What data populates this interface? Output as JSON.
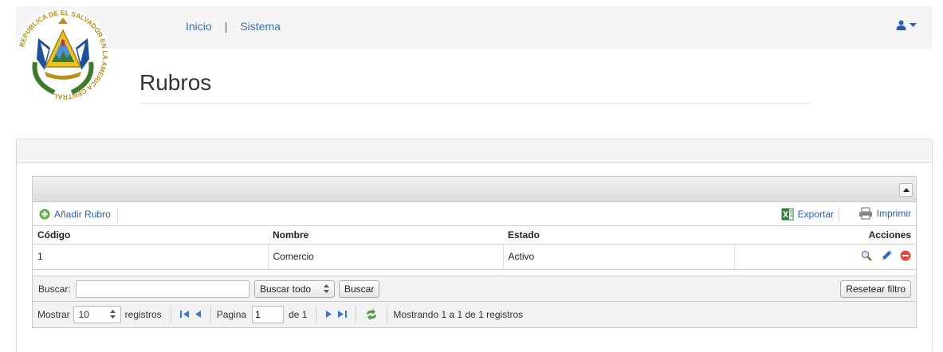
{
  "nav": {
    "links": [
      "Inicio",
      "Sistema"
    ],
    "separator": "|"
  },
  "colors": {
    "link": "#3a6fb5",
    "user_icon": "#2a5db0"
  },
  "logo": {
    "name": "el-salvador-coat-of-arms",
    "ring_text": "REPUBLICA DE EL SALVADOR EN LA AMERICA CENTRAL"
  },
  "page": {
    "title": "Rubros"
  },
  "grid": {
    "toolbar": {
      "add_label": "Añadir Rubro",
      "export_label": "Exportar",
      "print_label": "Imprimir"
    },
    "columns": [
      "Código",
      "Nombre",
      "Estado",
      "Acciones"
    ],
    "rows": [
      {
        "codigo": "1",
        "nombre": "Comercio",
        "estado": "Activo"
      }
    ],
    "action_icons": [
      "view-icon",
      "edit-icon",
      "delete-icon"
    ]
  },
  "search": {
    "label": "Buscar:",
    "value": "",
    "scope_selected": "Buscar todo",
    "search_button": "Buscar",
    "reset_button": "Resetear filtro"
  },
  "pager": {
    "show_label": "Mostrar",
    "page_size": "10",
    "records_label": "registros",
    "page_label": "Pagina",
    "current_page": "1",
    "of_label": "de 1",
    "summary": "Mostrando 1 a 1 de 1 registros"
  }
}
